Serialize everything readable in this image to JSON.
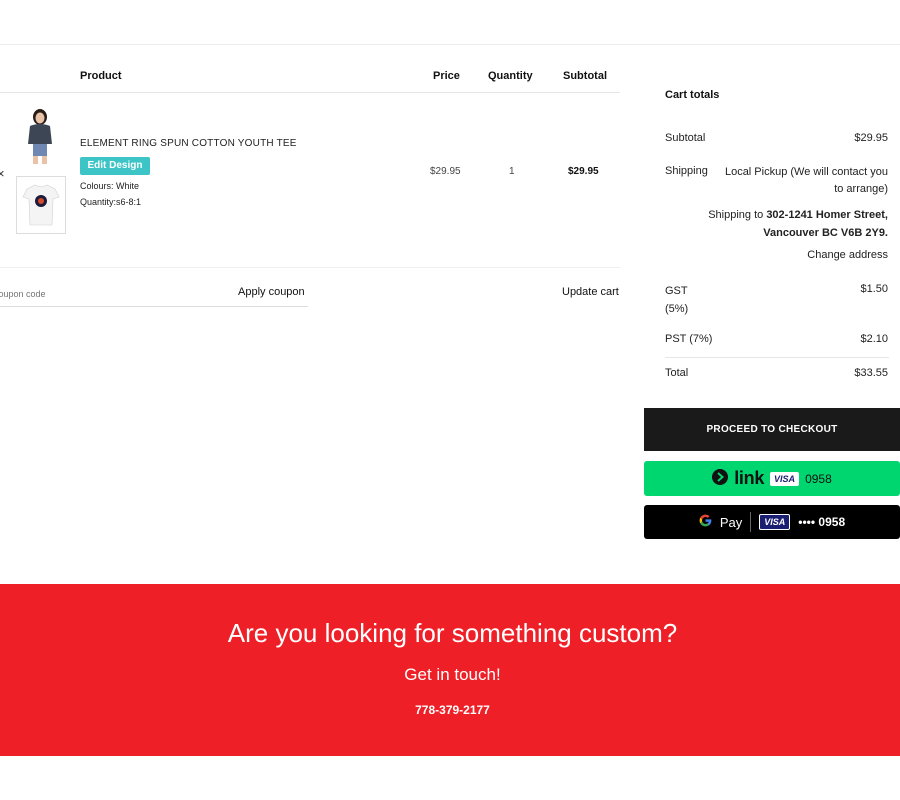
{
  "cart": {
    "headers": {
      "product": "Product",
      "price": "Price",
      "quantity": "Quantity",
      "subtotal": "Subtotal"
    },
    "remove_glyph": "×",
    "item": {
      "name": "ELEMENT RING SPUN COTTON YOUTH TEE",
      "edit_label": "Edit Design",
      "colours": "Colours: White",
      "quantity_detail": "Quantity:s6-8:1",
      "price": "$29.95",
      "quantity": "1",
      "subtotal": "$29.95"
    },
    "coupon_placeholder": "Coupon code",
    "apply_label": "Apply coupon",
    "update_label": "Update cart"
  },
  "totals": {
    "title": "Cart totals",
    "subtotal_label": "Subtotal",
    "subtotal_value": "$29.95",
    "shipping_label": "Shipping",
    "shipping_method": "Local Pickup (We will contact you to arrange)",
    "shipping_to_prefix": "Shipping to ",
    "shipping_address": "302-1241 Homer Street, Vancouver BC V6B 2Y9.",
    "change_address": "Change address",
    "gst_label": "GST (5%)",
    "gst_value": "$1.50",
    "pst_label": "PST (7%)",
    "pst_value": "$2.10",
    "total_label": "Total",
    "total_value": "$33.55",
    "checkout_label": "PROCEED TO CHECKOUT",
    "link_word": "link",
    "link_card": "0958",
    "gpay_text": "Pay",
    "gpay_card": "•••• 0958",
    "visa": "VISA"
  },
  "footer": {
    "title": "Are you looking for something custom?",
    "subtitle": "Get in touch!",
    "phone": "778-379-2177"
  },
  "colors": {
    "accent_teal": "#3cc4c7",
    "link_green": "#00d66f",
    "cta_red": "#ee1f26",
    "checkout_dark": "#1a1a1a"
  }
}
